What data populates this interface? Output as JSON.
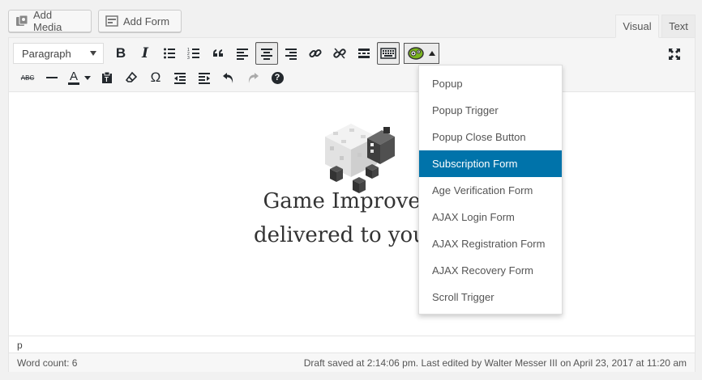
{
  "media_buttons": {
    "add_media": "Add Media",
    "add_form": "Add Form"
  },
  "tabs": {
    "visual": "Visual",
    "text": "Text"
  },
  "toolbar": {
    "format_select": "Paragraph",
    "row1_icons": [
      "bold-icon",
      "italic-icon",
      "bullet-list-icon",
      "numbered-list-icon",
      "blockquote-icon",
      "align-left-icon",
      "align-center-icon",
      "align-right-icon",
      "link-icon",
      "unlink-icon",
      "read-more-icon",
      "toolbar-toggle-icon"
    ],
    "row2_icons": [
      "strikethrough-icon",
      "horizontal-line-icon",
      "text-color-icon",
      "paste-text-icon",
      "clear-formatting-icon",
      "special-character-icon",
      "outdent-icon",
      "indent-icon",
      "undo-icon",
      "redo-icon",
      "help-icon"
    ],
    "bold": "B",
    "italic": "I",
    "strike": "ABC",
    "text_color": "A",
    "omega": "Ω",
    "help": "?"
  },
  "content": {
    "line1": "Game Improvem",
    "line2": "delivered to your i"
  },
  "statusbar": {
    "path": "p"
  },
  "footer": {
    "word_count": "Word count: 6",
    "draft_status": "Draft saved at 2:14:06 pm. Last edited by Walter Messer III on April 23, 2017 at 11:20 am"
  },
  "dropdown": {
    "items": [
      "Popup",
      "Popup Trigger",
      "Popup Close Button",
      "Subscription Form",
      "Age Verification Form",
      "AJAX Login Form",
      "AJAX Registration Form",
      "AJAX Recovery Form",
      "Scroll Trigger"
    ],
    "selected_index": 3
  },
  "colors": {
    "accent": "#0073aa",
    "plugin_icon_green": "#7ab51d"
  }
}
